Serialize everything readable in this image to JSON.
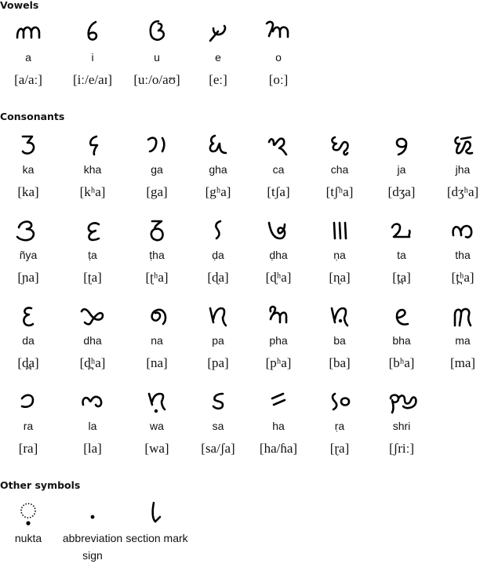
{
  "sections": {
    "vowels_title": "Vowels",
    "consonants_title": "Consonants",
    "other_title": "Other symbols"
  },
  "vowels": [
    {
      "glyph": "a-letter-glyph",
      "translit": "a",
      "ipa": "[a/aː]"
    },
    {
      "glyph": "i-letter-glyph",
      "translit": "i",
      "ipa": "[iː/e/aɪ]"
    },
    {
      "glyph": "u-letter-glyph",
      "translit": "u",
      "ipa": "[uː/o/aʊ]"
    },
    {
      "glyph": "e-letter-glyph",
      "translit": "e",
      "ipa": "[eː]"
    },
    {
      "glyph": "o-letter-glyph",
      "translit": "o",
      "ipa": "[oː]"
    }
  ],
  "consonants": [
    {
      "glyph": "ka-glyph",
      "translit": "ka",
      "ipa": "[ka]"
    },
    {
      "glyph": "kha-glyph",
      "translit": "kha",
      "ipa": "[kʰa]"
    },
    {
      "glyph": "ga-glyph",
      "translit": "ga",
      "ipa": "[ga]"
    },
    {
      "glyph": "gha-glyph",
      "translit": "gha",
      "ipa": "[gʰa]"
    },
    {
      "glyph": "ca-glyph",
      "translit": "ca",
      "ipa": "[tʃa]"
    },
    {
      "glyph": "cha-glyph",
      "translit": "cha",
      "ipa": "[tʃʰa]"
    },
    {
      "glyph": "ja-glyph",
      "translit": "ja",
      "ipa": "[dʒa]"
    },
    {
      "glyph": "jha-glyph",
      "translit": "jha",
      "ipa": "[dʒʰa]"
    },
    {
      "glyph": "nya-glyph",
      "translit": "ñya",
      "ipa": "[ɲa]"
    },
    {
      "glyph": "tta-glyph",
      "translit": "ṭa",
      "ipa": "[ʈa]"
    },
    {
      "glyph": "ttha-glyph",
      "translit": "ṭha",
      "ipa": "[ʈʰa]"
    },
    {
      "glyph": "dda-glyph",
      "translit": "ḍa",
      "ipa": "[ɖa]"
    },
    {
      "glyph": "ddha-glyph",
      "translit": "ḍha",
      "ipa": "[ɖʰa]"
    },
    {
      "glyph": "nna-glyph",
      "translit": "ṇa",
      "ipa": "[ɳa]"
    },
    {
      "glyph": "ta-glyph",
      "translit": "ta",
      "ipa": "[t̪a]"
    },
    {
      "glyph": "tha-glyph",
      "translit": "tha",
      "ipa": "[t̪ʰa]"
    },
    {
      "glyph": "da-glyph",
      "translit": "da",
      "ipa": "[d̪a]"
    },
    {
      "glyph": "dha-glyph",
      "translit": "dha",
      "ipa": "[d̪ʰa]"
    },
    {
      "glyph": "na-glyph",
      "translit": "na",
      "ipa": "[na]"
    },
    {
      "glyph": "pa-glyph",
      "translit": "pa",
      "ipa": "[pa]"
    },
    {
      "glyph": "pha-glyph",
      "translit": "pha",
      "ipa": "[pʰa]"
    },
    {
      "glyph": "ba-glyph",
      "translit": "ba",
      "ipa": "[ba]"
    },
    {
      "glyph": "bha-glyph",
      "translit": "bha",
      "ipa": "[bʰa]"
    },
    {
      "glyph": "ma-glyph",
      "translit": "ma",
      "ipa": "[ma]"
    },
    {
      "glyph": "ra-glyph",
      "translit": "ra",
      "ipa": "[ra]"
    },
    {
      "glyph": "la-glyph",
      "translit": "la",
      "ipa": "[la]"
    },
    {
      "glyph": "wa-glyph",
      "translit": "wa",
      "ipa": "[wa]"
    },
    {
      "glyph": "sa-glyph",
      "translit": "sa",
      "ipa": "[sa/ʃa]"
    },
    {
      "glyph": "ha-glyph",
      "translit": "ha",
      "ipa": "[ha/ɦa]"
    },
    {
      "glyph": "rra-glyph",
      "translit": "ṛa",
      "ipa": "[ɽa]"
    },
    {
      "glyph": "shri-glyph",
      "translit": "shri",
      "ipa": "[ʃriː]"
    }
  ],
  "other_symbols": [
    {
      "glyph": "nukta-glyph",
      "label": "nukta"
    },
    {
      "glyph": "abbreviation-sign-glyph",
      "label": "abbreviation sign"
    },
    {
      "glyph": "section-mark-glyph",
      "label": "section mark"
    }
  ]
}
